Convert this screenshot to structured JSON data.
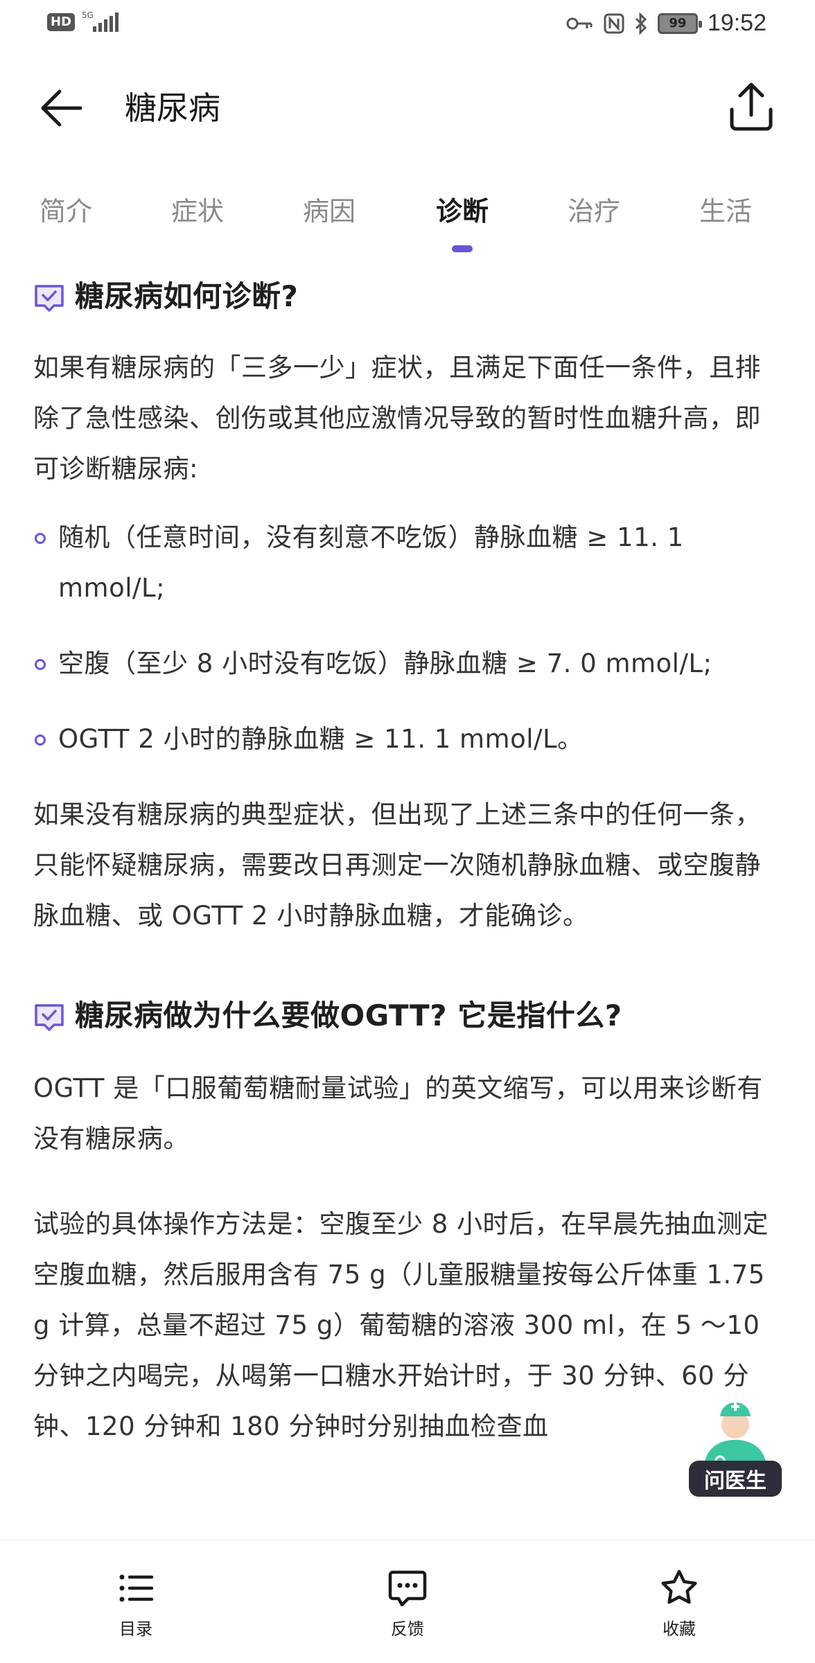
{
  "status_bar": {
    "hd": "HD",
    "network": "5G",
    "battery": "99",
    "time": "19:52"
  },
  "header": {
    "title": "糖尿病"
  },
  "tabs": [
    "简介",
    "症状",
    "病因",
    "诊断",
    "治疗",
    "生活"
  ],
  "active_tab": "诊断",
  "accent_color": "#6a55d6",
  "sections": {
    "s1": {
      "title": "糖尿病如何诊断?",
      "intro": "如果有糖尿病的「三多一少」症状，且满足下面任一条件，且排除了急性感染、创伤或其他应激情况导致的暂时性血糖升高，即可诊断糖尿病:",
      "bullets": [
        "随机（任意时间，没有刻意不吃饭）静脉血糖 ≥ 11. 1 mmol/L;",
        "空腹（至少 8 小时没有吃饭）静脉血糖 ≥ 7. 0 mmol/L;",
        "OGTT 2 小时的静脉血糖 ≥ 11. 1 mmol/L。"
      ],
      "outro": "如果没有糖尿病的典型症状，但出现了上述三条中的任何一条，只能怀疑糖尿病，需要改日再测定一次随机静脉血糖、或空腹静脉血糖、或 OGTT 2 小时静脉血糖，才能确诊。"
    },
    "s2": {
      "title": "糖尿病做为什么要做OGTT? 它是指什么?",
      "p1": "OGTT 是「口服葡萄糖耐量试验」的英文缩写，可以用来诊断有没有糖尿病。",
      "p2": "试验的具体操作方法是：空腹至少 8 小时后，在早晨先抽血测定空腹血糖，然后服用含有 75 g（儿童服糖量按每公斤体重 1.75 g 计算，总量不超过 75 g）葡萄糖的溶液 300 ml，在 5 ～10 分钟之内喝完，从喝第一口糖水开始计时，于 30 分钟、60 分钟、120 分钟和 180 分钟时分别抽血检查血"
    }
  },
  "floating": {
    "ask_doctor": "问医生"
  },
  "bottom_bar": {
    "toc": "目录",
    "feedback": "反馈",
    "favorite": "收藏"
  }
}
